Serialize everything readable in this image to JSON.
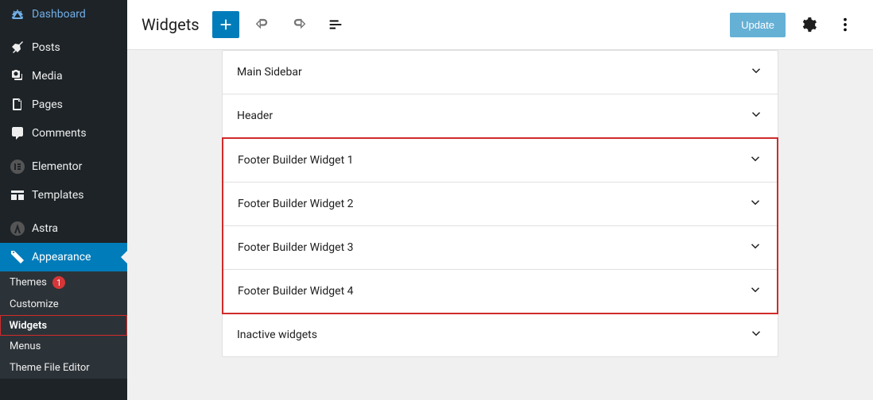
{
  "sidebar": {
    "items": [
      {
        "label": "Dashboard",
        "icon": "dashboard"
      },
      {
        "label": "Posts",
        "icon": "pin"
      },
      {
        "label": "Media",
        "icon": "media"
      },
      {
        "label": "Pages",
        "icon": "page"
      },
      {
        "label": "Comments",
        "icon": "comment"
      },
      {
        "label": "Elementor",
        "icon": "elementor"
      },
      {
        "label": "Templates",
        "icon": "templates"
      },
      {
        "label": "Astra",
        "icon": "astra"
      },
      {
        "label": "Appearance",
        "icon": "appearance",
        "active": true
      }
    ],
    "submenu": [
      {
        "label": "Themes",
        "badge": "1"
      },
      {
        "label": "Customize"
      },
      {
        "label": "Widgets",
        "bold": true,
        "highlighted": true
      },
      {
        "label": "Menus"
      },
      {
        "label": "Theme File Editor"
      }
    ]
  },
  "toolbar": {
    "title": "Widgets",
    "update_label": "Update"
  },
  "widget_areas": {
    "top": [
      {
        "title": "Main Sidebar"
      },
      {
        "title": "Header"
      }
    ],
    "highlighted": [
      {
        "title": "Footer Builder Widget 1"
      },
      {
        "title": "Footer Builder Widget 2"
      },
      {
        "title": "Footer Builder Widget 3"
      },
      {
        "title": "Footer Builder Widget 4"
      }
    ],
    "bottom": [
      {
        "title": "Inactive widgets"
      }
    ]
  }
}
